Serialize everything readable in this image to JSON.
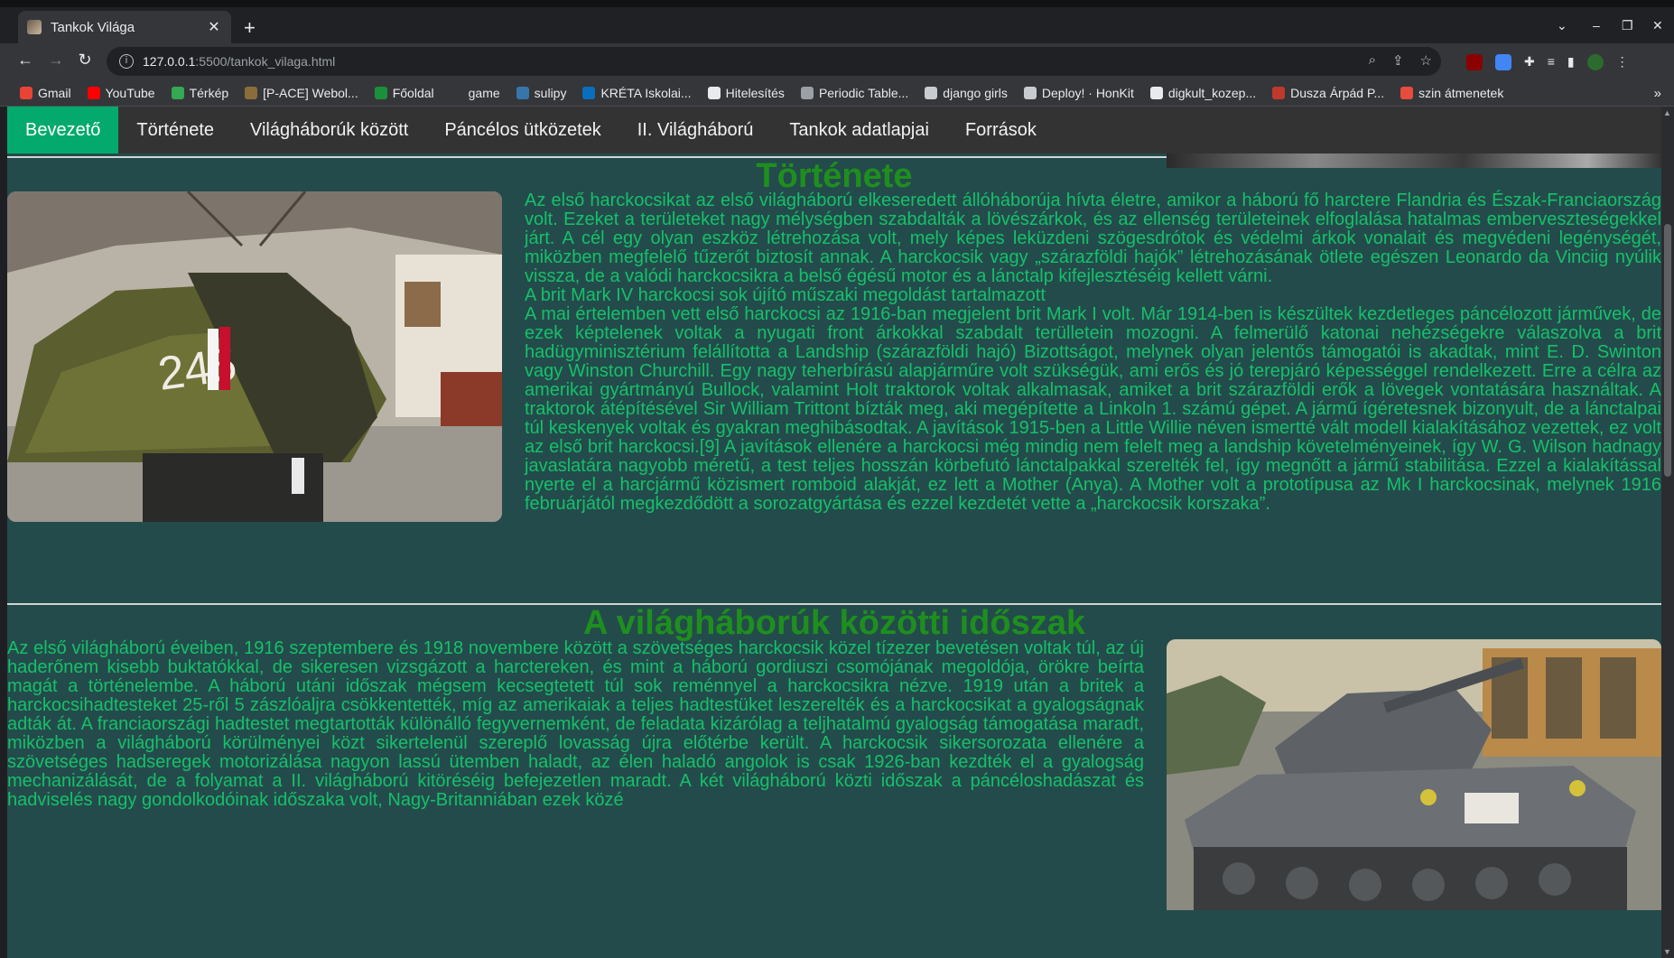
{
  "browser": {
    "tab_title": "Tankok Világa",
    "url_host": "127.0.0.1",
    "url_path": ":5500/tankok_vilaga.html",
    "bookmarks": [
      {
        "label": "Gmail",
        "color": "#ea4335"
      },
      {
        "label": "YouTube",
        "color": "#ff0000"
      },
      {
        "label": "Térkép",
        "color": "#34a853"
      },
      {
        "label": "[P-ACE] Webol...",
        "color": "#8a6d3b"
      },
      {
        "label": "Főoldal",
        "color": "#1b8f3a"
      },
      {
        "label": "game",
        "color": "#35363a"
      },
      {
        "label": "sulipy",
        "color": "#3776ab"
      },
      {
        "label": "KRÉTA Iskolai...",
        "color": "#0a6ebd"
      },
      {
        "label": "Hitelesítés",
        "color": "#e8eaed"
      },
      {
        "label": "Periodic Table...",
        "color": "#9aa0a6"
      },
      {
        "label": "django girls",
        "color": "#c8cbd0"
      },
      {
        "label": "Deploy! · HonKit",
        "color": "#c8cbd0"
      },
      {
        "label": "digkult_kozep...",
        "color": "#e8eaed"
      },
      {
        "label": "Dusza Árpád P...",
        "color": "#c0392b"
      },
      {
        "label": "szin átmenetek",
        "color": "#e74c3c"
      }
    ],
    "bookmarks_more": "»"
  },
  "nav": {
    "items": [
      {
        "label": "Bevezető",
        "active": true
      },
      {
        "label": "Története",
        "active": false
      },
      {
        "label": "Világháborúk között",
        "active": false
      },
      {
        "label": "Páncélos ütközetek",
        "active": false
      },
      {
        "label": "II. Világháború",
        "active": false
      },
      {
        "label": "Tankok adatlapjai",
        "active": false
      },
      {
        "label": "Források",
        "active": false
      }
    ]
  },
  "section_history": {
    "title": "Története",
    "image_label": "245",
    "paragraph1": "Az első harckocsikat az első világháború elkeseredett állóháborúja hívta életre, amikor a háború fő harctere Flandria és Észak-Franciaország volt. Ezeket a területeket nagy mélységben szabdalták a lövészárkok, és az ellenség területeinek elfoglalása hatalmas emberveszteségekkel járt. A cél egy olyan eszköz létrehozása volt, mely képes leküzdeni szögesdrótok és védelmi árkok vonalait és megvédeni legénységét, miközben megfelelő tűzerőt biztosít annak. A harckocsik vagy „szárazföldi hajók” létrehozásának ötlete egészen Leonardo da Vinciig nyúlik vissza, de a valódi harckocsikra a belső égésű motor és a lánctalp kifejlesztéséig kellett várni.",
    "caption": "A brit Mark IV harckocsi sok újító műszaki megoldást tartalmazott",
    "paragraph2": "A mai értelemben vett első harckocsi az 1916-ban megjelent brit Mark I volt. Már 1914-ben is készültek kezdetleges páncélozott járművek, de ezek képtelenek voltak a nyugati front árkokkal szabdalt terülletein mozogni. A felmerülő katonai nehézségekre válaszolva a brit hadügyminisztérium felállította a Landship (szárazföldi hajó) Bizottságot, melynek olyan jelentős támogatói is akadtak, mint E. D. Swinton vagy Winston Churchill. Egy nagy teherbírású alapjárműre volt szükségük, ami erős és jó terepjáró képességgel rendelkezett. Erre a célra az amerikai gyártmányú Bullock, valamint Holt traktorok voltak alkalmasak, amiket a brit szárazföldi erők a lövegek vontatására használtak. A traktorok átépítésével Sir William Trittont bízták meg, aki megépítette a Linkoln 1. számú gépet. A jármű ígéretesnek bizonyult, de a lánctalpai túl keskenyek voltak és gyakran meghibásodtak. A javítások 1915-ben a Little Willie néven ismertté vált modell kialakításához vezettek, ez volt az első brit harckocsi.[9] A javítások ellenére a harckocsi még mindig nem felelt meg a landship követelményeinek, így W. G. Wilson hadnagy javaslatára nagyobb méretű, a test teljes hosszán körbefutó lánctalpakkal szerelték fel, így megnőtt a jármű stabilitása. Ezzel a kialakítással nyerte el a harcjármű közismert romboid alakját, ez lett a Mother (Anya). A Mother volt a prototípusa az Mk I harckocsinak, melynek 1916 februárjától megkezdődött a sorozatgyártása és ezzel kezdetét vette a „harckocsik korszaka”."
  },
  "section_interwar": {
    "title": "A világháborúk közötti időszak",
    "paragraph1": "Az első világháború éveiben, 1916 szeptembere és 1918 novembere között a szövetséges harckocsik közel tízezer bevetésen voltak túl, az új haderőnem kisebb buktatókkal, de sikeresen vizsgázott a harctereken, és mint a háború gordiuszi csomójának megoldója, örökre beírta magát a történelembe. A háború utáni időszak mégsem kecsegtetett túl sok reménnyel a harckocsikra nézve. 1919 után a britek a harckocsihadtesteket 25-ről 5 zászlóaljra csökkentették, míg az amerikaiak a teljes hadtestüket leszerelték és a harckocsikat a gyalogságnak adták át. A franciaországi hadtestet megtartották különálló fegyvernemként, de feladata kizárólag a teljhatalmú gyalogság támogatása maradt, miközben a világháború körülményei közt sikertelenül szereplő lovasság újra előtérbe került. A harckocsik sikersorozata ellenére a szövetséges hadseregek motorizálása nagyon lassú ütemben haladt, az élen haladó angolok is csak 1926-ban kezdték el a gyalogság mechanizálását, de a folyamat a II. világháború kitöréséig befejezetlen maradt. A két világháború közti időszak a páncéloshadászat és hadviselés nagy gondolkodóinak időszaka volt, Nagy-Britanniában ezek közé"
  }
}
